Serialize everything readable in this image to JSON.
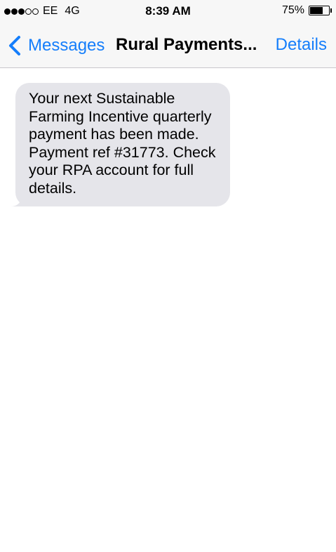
{
  "status_bar": {
    "signal_strength": "3 of 5",
    "carrier": "EE",
    "network": "4G",
    "time": "8:39 AM",
    "battery_percent": "75%",
    "battery_level": 0.75
  },
  "nav_bar": {
    "back_label": "Messages",
    "title": "Rural Payments...",
    "details_label": "Details",
    "accent_color": "#157efb"
  },
  "messages": [
    {
      "direction": "incoming",
      "text": "Your next Sustainable Farming Incentive quarterly payment has been made. Payment ref #31773. Check your RPA account for full details.",
      "bubble_color": "#e5e5ea"
    }
  ]
}
